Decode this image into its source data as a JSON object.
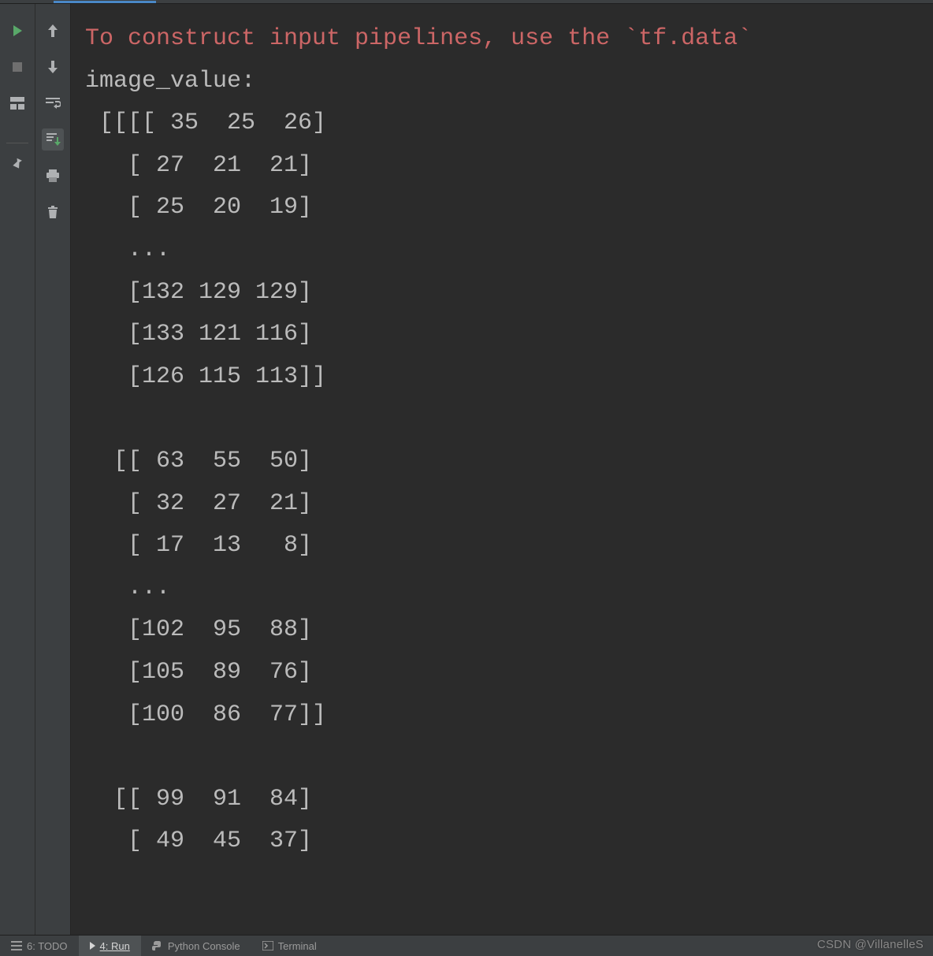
{
  "console": {
    "warning_line": "To construct input pipelines, use the `tf.data`",
    "label": "image_value:",
    "array_text": " [[[[ 35  25  26]\n   [ 27  21  21]\n   [ 25  20  19]\n   ...\n   [132 129 129]\n   [133 121 116]\n   [126 115 113]]\n\n  [[ 63  55  50]\n   [ 32  27  21]\n   [ 17  13   8]\n   ...\n   [102  95  88]\n   [105  89  76]\n   [100  86  77]]\n\n  [[ 99  91  84]\n   [ 49  45  37]"
  },
  "left_gutter_icons": {
    "run": "run-icon",
    "stop": "stop-icon",
    "layout": "layout-icon",
    "pin": "pin-icon"
  },
  "mid_gutter_icons": {
    "up": "arrow-up-icon",
    "down": "arrow-down-icon",
    "soft_wrap": "soft-wrap-icon",
    "scroll_end": "scroll-to-end-icon",
    "print": "print-icon",
    "trash": "trash-icon"
  },
  "status_bar": {
    "todo": "6: TODO",
    "run": "4: Run",
    "python_console": "Python Console",
    "terminal": "Terminal"
  },
  "watermark": "CSDN @VillanelleS"
}
